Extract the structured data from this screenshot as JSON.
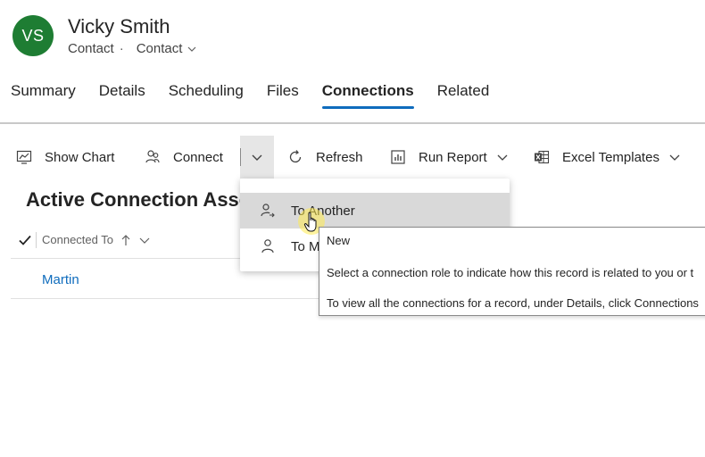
{
  "record": {
    "initials": "VS",
    "name": "Vicky Smith",
    "entity": "Contact",
    "separator": "·",
    "form": "Contact",
    "avatar_color": "#1e7d33"
  },
  "tabs": [
    {
      "label": "Summary",
      "active": false
    },
    {
      "label": "Details",
      "active": false
    },
    {
      "label": "Scheduling",
      "active": false
    },
    {
      "label": "Files",
      "active": false
    },
    {
      "label": "Connections",
      "active": true
    },
    {
      "label": "Related",
      "active": false
    }
  ],
  "commands": {
    "show_chart": "Show Chart",
    "connect": "Connect",
    "refresh": "Refresh",
    "run_report": "Run Report",
    "excel_templates": "Excel Templates"
  },
  "grid": {
    "title": "Active Connection Asso",
    "column": "Connected To",
    "rows": [
      "Martin"
    ]
  },
  "menu": {
    "items": [
      "To Another",
      "To M"
    ]
  },
  "tooltip": {
    "title": "New",
    "line1": "Select a connection role to indicate how this record is related to you or t",
    "line2": "To view all the connections for a record, under Details, click Connections"
  },
  "colors": {
    "accent": "#0f6cbd",
    "hover": "#d9d9d9"
  }
}
